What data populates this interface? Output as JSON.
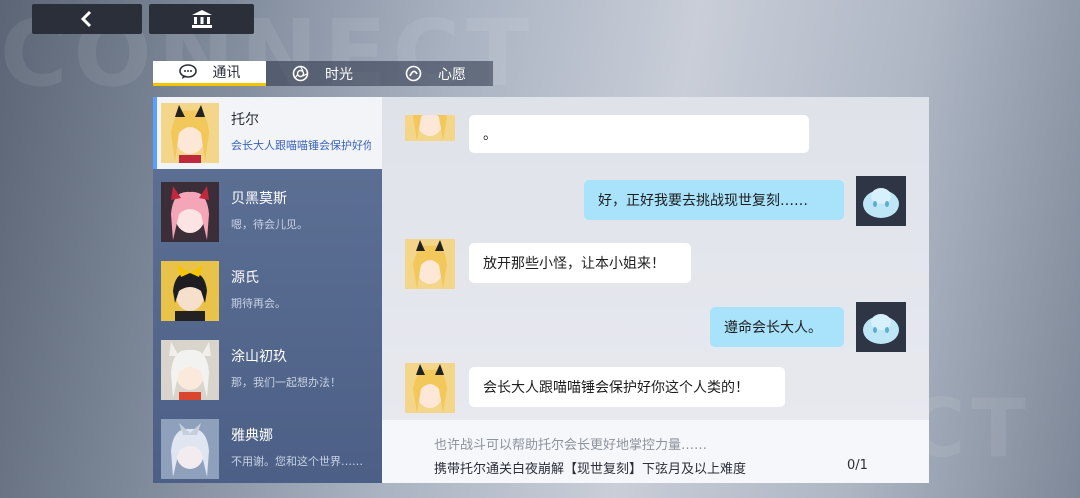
{
  "background": {
    "watermark_top": "CONNECT",
    "watermark_bottom": "NNECT"
  },
  "top_buttons": [
    {
      "name": "back",
      "icon": "chevron-left-icon"
    },
    {
      "name": "home",
      "icon": "museum-icon"
    }
  ],
  "tabs": [
    {
      "label": "通讯",
      "icon": "chat-bubble-icon",
      "active": true
    },
    {
      "label": "时光",
      "icon": "aperture-icon",
      "active": false
    },
    {
      "label": "心愿",
      "icon": "wish-icon",
      "active": false
    }
  ],
  "contacts": [
    {
      "name": "托尔",
      "preview": "会长大人跟喵喵锤会保护好你这个人类的！",
      "active": true
    },
    {
      "name": "贝黑莫斯",
      "preview": "嗯，待会儿见。",
      "active": false
    },
    {
      "name": "源氏",
      "preview": "期待再会。",
      "active": false
    },
    {
      "name": "涂山初玖",
      "preview": "那，我们一起想办法！",
      "active": false
    },
    {
      "name": "雅典娜",
      "preview": "不用谢。您和这个世界……",
      "active": false
    }
  ],
  "messages": [
    {
      "side": "left",
      "text": "。"
    },
    {
      "side": "right",
      "text": "好，正好我要去挑战现世复刻……"
    },
    {
      "side": "left",
      "text": "放开那些小怪，让本小姐来！"
    },
    {
      "side": "right",
      "text": "遵命会长大人。"
    },
    {
      "side": "left",
      "text": "会长大人跟喵喵锤会保护好你这个人类的！"
    }
  ],
  "footer": {
    "hint": "也许战斗可以帮助托尔会长更好地掌控力量……",
    "task": "携带托尔通关白夜崩解【现世复刻】下弦月及以上难度",
    "progress": "0/1"
  },
  "colors": {
    "accent_yellow": "#f5c400",
    "bubble_right": "#a8e3fb",
    "sidebar": "#5a6d92",
    "active_bar": "#5aa0ff"
  }
}
